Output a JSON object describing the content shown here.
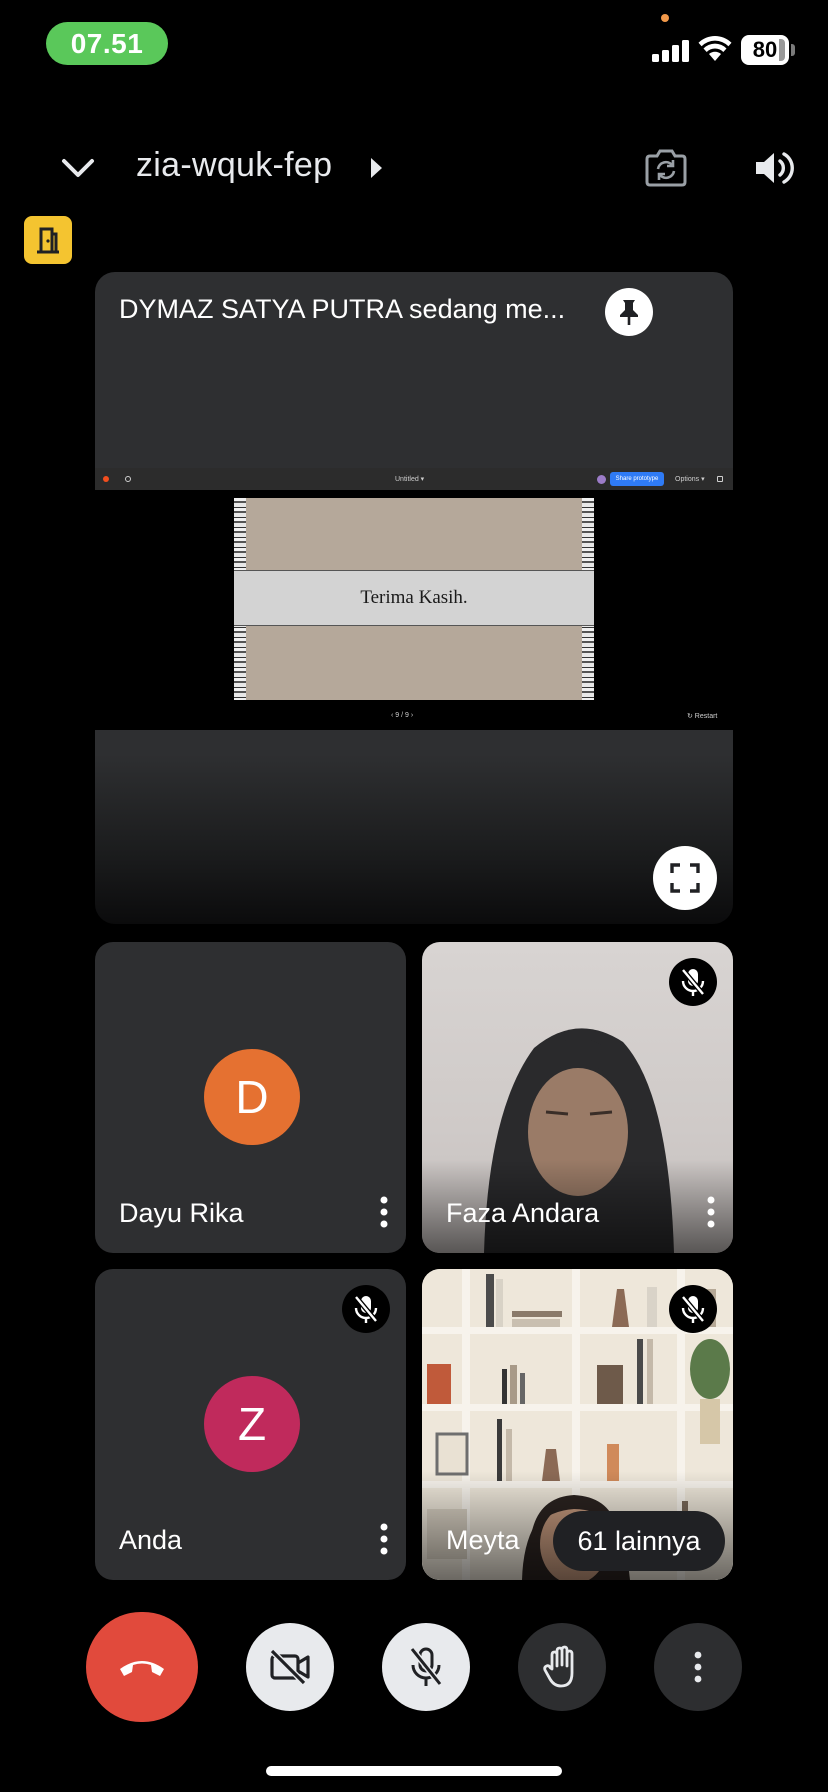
{
  "status_bar": {
    "time": "07.51",
    "battery_level": "80",
    "colors": {
      "time_pill": "#5ac85a",
      "privacy_dot": "#f2994a"
    }
  },
  "header": {
    "meeting_code": "zia-wquk-fep",
    "icons": [
      "chevron-down-icon",
      "chevron-right-icon",
      "camera-switch-icon",
      "speaker-icon",
      "room-door-icon"
    ]
  },
  "presentation": {
    "title": "DYMAZ SATYA PUTRA sedang me...",
    "shared_screen": {
      "document_name": "Untitled ▾",
      "share_button": "Share prototype",
      "options_label": "Options ▾",
      "slide_text": "Terima Kasih.",
      "pager": "‹  9 / 9  ›",
      "restart_label": "↻ Restart"
    }
  },
  "participants": [
    {
      "name": "Dayu Rika",
      "initial": "D",
      "avatar_color": "#e57131",
      "muted": false
    },
    {
      "name": "Faza Andara",
      "initial": "",
      "avatar_color": "",
      "muted": true
    },
    {
      "name": "Anda",
      "initial": "Z",
      "avatar_color": "#c02a5c",
      "muted": true
    },
    {
      "name": "Meyta",
      "initial": "",
      "avatar_color": "",
      "muted": true
    }
  ],
  "more_participants": "61 lainnya",
  "controls": {
    "end_call_color": "#e14a3c",
    "buttons": [
      "end-call",
      "camera-off",
      "mic-off",
      "raise-hand",
      "more-options"
    ]
  }
}
